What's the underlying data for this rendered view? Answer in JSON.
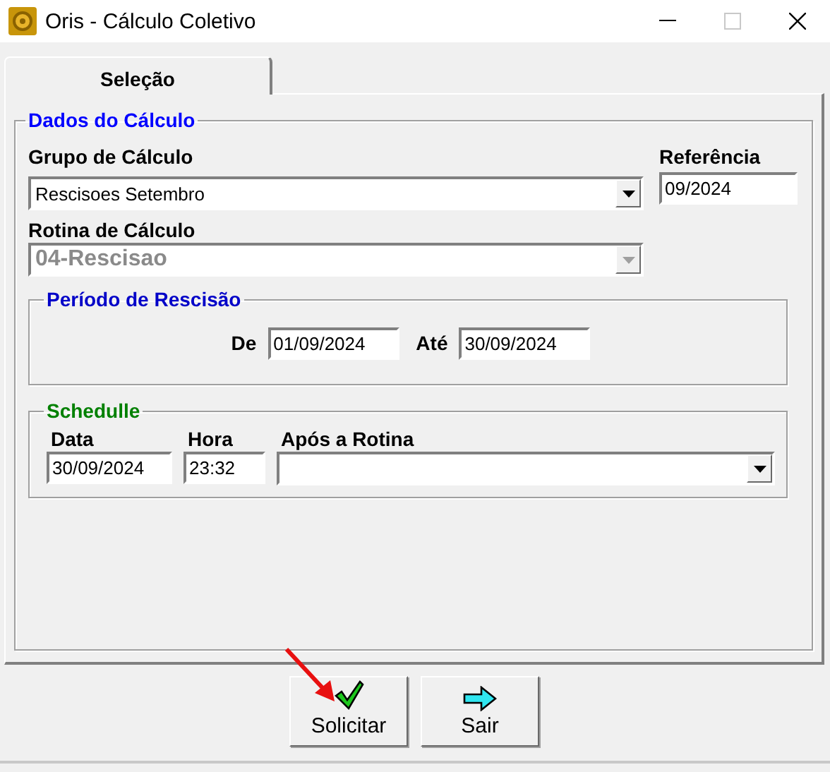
{
  "window": {
    "title": "Oris - Cálculo Coletivo"
  },
  "tabs": [
    {
      "label": "Seleção",
      "selected": true
    }
  ],
  "calc": {
    "title": "Dados do Cálculo",
    "grupo": {
      "label": "Grupo de Cálculo",
      "value": "Rescisoes Setembro",
      "disabled": false
    },
    "referencia": {
      "label": "Referência",
      "value": "09/2024"
    },
    "rotina": {
      "label": "Rotina de Cálculo",
      "value": "04-Rescisao",
      "disabled": true
    }
  },
  "periodo": {
    "title": "Período de Rescisão",
    "from": {
      "label": "De",
      "value": "01/09/2024"
    },
    "to": {
      "label": "Até",
      "value": "30/09/2024"
    }
  },
  "schedule": {
    "title": "Schedulle",
    "fields": [
      {
        "label": "Data",
        "value": "30/09/2024",
        "kind": "text"
      },
      {
        "label": "Hora",
        "value": "23:32",
        "kind": "text"
      },
      {
        "label": "Após a Rotina",
        "kind": "combo"
      }
    ]
  },
  "buttons": [
    {
      "label": "Solicitar",
      "kind": "check"
    },
    {
      "label": "Sair",
      "kind": "arrow"
    }
  ]
}
